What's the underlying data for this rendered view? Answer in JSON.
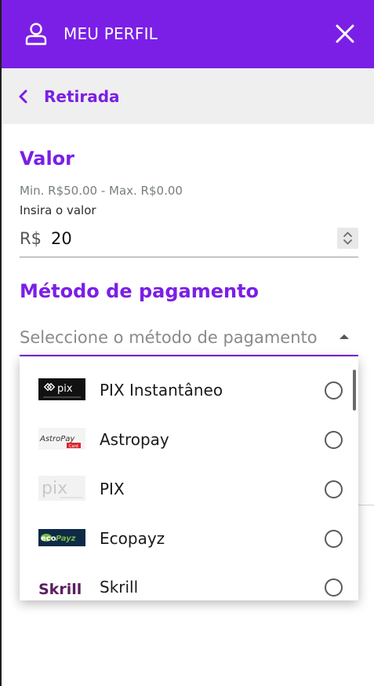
{
  "header": {
    "title": "MEU PERFIL",
    "user_icon": "user-icon",
    "close_icon": "close-icon",
    "background": "#7b1fe6"
  },
  "subheader": {
    "back_label": "Retirada",
    "back_icon": "chevron-left-icon"
  },
  "valor": {
    "title": "Valor",
    "range": "Min. R$50.00 - Max. R$0.00",
    "hint": "Insira o valor",
    "currency": "R$",
    "value": "20"
  },
  "payment": {
    "title": "Método de pagamento",
    "placeholder": "Seleccione o método de pagamento",
    "caret_icon": "caret-up-icon",
    "options": [
      {
        "label": "PIX Instantâneo",
        "logo": "pix-instant-logo"
      },
      {
        "label": "Astropay",
        "logo": "astropay-logo"
      },
      {
        "label": "PIX",
        "logo": "pix-logo"
      },
      {
        "label": "Ecopayz",
        "logo": "ecopayz-logo"
      },
      {
        "label": "Skrill",
        "logo": "skrill-logo"
      }
    ]
  },
  "colors": {
    "accent": "#7b1fe6",
    "subheader_bg": "#efefef",
    "skrill": "#5b1e5f",
    "ecopayz": "#0e2a47"
  }
}
